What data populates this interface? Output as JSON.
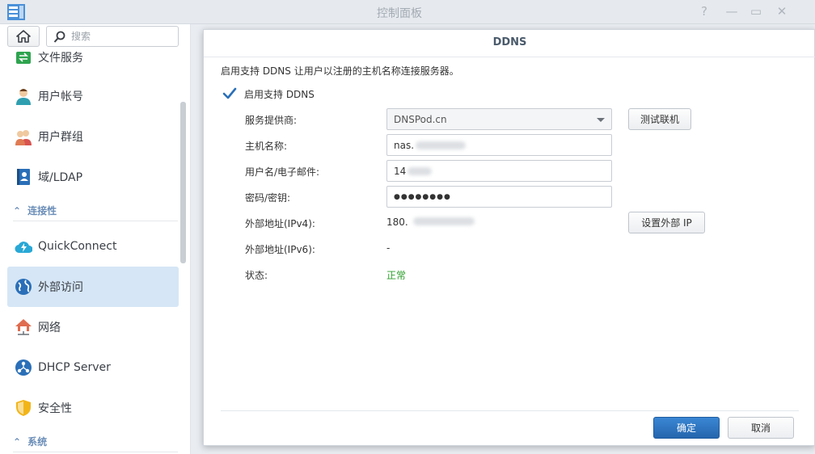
{
  "window": {
    "title": "控制面板",
    "buttons": [
      "?",
      "—",
      "▭",
      "✕"
    ]
  },
  "sidebar": {
    "search_placeholder": "搜索",
    "items": [
      {
        "label": "文件服务",
        "icon": "file-services-icon"
      },
      {
        "label": "用户帐号",
        "icon": "user-icon"
      },
      {
        "label": "用户群组",
        "icon": "group-icon"
      },
      {
        "label": "域/LDAP",
        "icon": "domain-ldap-icon"
      },
      {
        "label": "QuickConnect",
        "icon": "quickconnect-icon"
      },
      {
        "label": "外部访问",
        "icon": "external-access-icon",
        "active": true
      },
      {
        "label": "网络",
        "icon": "network-icon"
      },
      {
        "label": "DHCP Server",
        "icon": "dhcp-icon"
      },
      {
        "label": "安全性",
        "icon": "security-shield-icon"
      }
    ],
    "sections": [
      "连接性",
      "系统"
    ]
  },
  "dialog": {
    "title": "DDNS",
    "description": "启用支持 DDNS 让用户以注册的主机名称连接服务器。",
    "enable_label": "启用支持 DDNS",
    "enable_checked": true,
    "fields": {
      "provider_label": "服务提供商:",
      "provider_value": "DNSPod.cn",
      "hostname_label": "主机名称:",
      "hostname_value": "nas.",
      "username_label": "用户名/电子邮件:",
      "username_value": "14",
      "password_label": "密码/密钥:",
      "password_value": "●●●●●●●●",
      "ipv4_label": "外部地址(IPv4):",
      "ipv4_value": "180.",
      "ipv6_label": "外部地址(IPv6):",
      "ipv6_value": "-",
      "status_label": "状态:",
      "status_value": "正常"
    },
    "buttons": {
      "test": "测试联机",
      "set_ip": "设置外部 IP",
      "ok": "确定",
      "cancel": "取消"
    },
    "colors": {
      "primary": "#2a6fb8",
      "status_ok": "#2e9e2e",
      "active_nav": "#d6e6f6"
    }
  }
}
